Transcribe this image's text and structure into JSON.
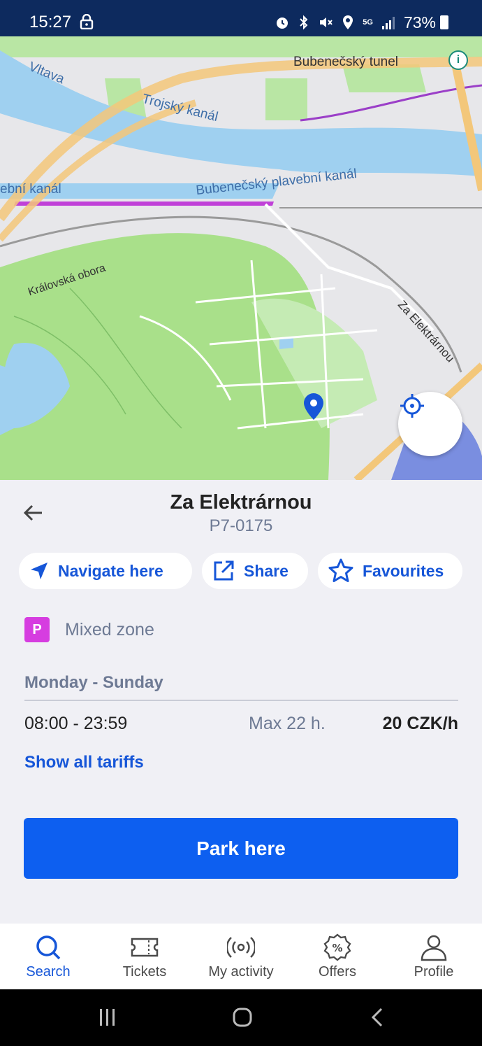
{
  "status_bar": {
    "time": "15:27",
    "network": "5G",
    "battery": "73%",
    "icons": [
      "lock-icon",
      "alarm-icon",
      "bluetooth-icon",
      "mute-icon",
      "location-icon",
      "signal-icon",
      "battery-icon"
    ]
  },
  "map": {
    "labels": {
      "vltava": "Vltava",
      "trojsky": "Trojský kanál",
      "bubenecsky_tunel": "Bubenečský tunel",
      "plavebni_left": "ební kanál",
      "plavebni": "Bubenečský plavební kanál",
      "kralovska": "Královská obora",
      "za_elektrarnou": "Za Elektrárnou"
    },
    "colors": {
      "water": "#9fd0f0",
      "park": "#a9e08a",
      "road": "#f3c77a",
      "base": "#e7e7ea"
    }
  },
  "detail": {
    "title": "Za Elektrárnou",
    "code": "P7-0175",
    "actions": {
      "navigate": "Navigate here",
      "share": "Share",
      "favourites": "Favourites"
    },
    "zone": {
      "badge": "P",
      "label": "Mixed zone",
      "color": "#d63de0"
    },
    "schedule": {
      "days": "Monday - Sunday",
      "time": "08:00 - 23:59",
      "max": "Max 22 h.",
      "price": "20 CZK/h"
    },
    "show_all": "Show all tariffs",
    "park_button": "Park here"
  },
  "bottom_nav": [
    {
      "label": "Search",
      "active": true
    },
    {
      "label": "Tickets",
      "active": false
    },
    {
      "label": "My activity",
      "active": false
    },
    {
      "label": "Offers",
      "active": false
    },
    {
      "label": "Profile",
      "active": false
    }
  ],
  "accent": "#1656d8"
}
